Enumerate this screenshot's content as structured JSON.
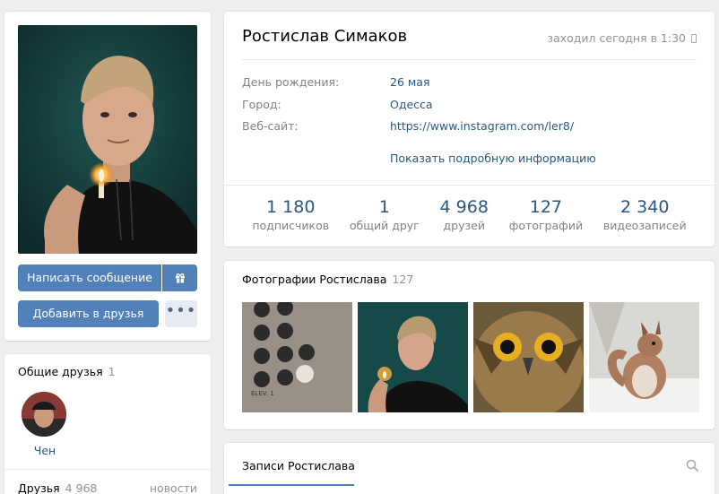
{
  "profile": {
    "name": "Ростислав Симаков",
    "last_seen": "заходил сегодня в 1:30",
    "info": [
      {
        "label": "День рождения:",
        "value": "26 мая"
      },
      {
        "label": "Город:",
        "value": "Одесса"
      },
      {
        "label": "Веб-сайт:",
        "value": "https://www.instagram.com/ler8/"
      }
    ],
    "show_more": "Показать подробную информацию",
    "counters": [
      {
        "value": "1 180",
        "label": "подписчиков"
      },
      {
        "value": "1",
        "label": "общий друг"
      },
      {
        "value": "4 968",
        "label": "друзей"
      },
      {
        "value": "127",
        "label": "фотографий"
      },
      {
        "value": "2 340",
        "label": "видеозаписей"
      }
    ]
  },
  "actions": {
    "message": "Написать сообщение",
    "add_friend": "Добавить в друзья",
    "more": "•••",
    "gift_icon": "gift-icon"
  },
  "mutual": {
    "title": "Общие друзья",
    "count": "1",
    "friends": [
      {
        "name": "Чен"
      }
    ]
  },
  "friends": {
    "title": "Друзья",
    "count": "4 968",
    "news": "новости"
  },
  "photos": {
    "title": "Фотографии Ростислава",
    "count": "127"
  },
  "posts": {
    "tab": "Записи Ростислава",
    "search_icon": "search-icon"
  },
  "colors": {
    "accent": "#5181b8",
    "link": "#2a5885",
    "background": "#edeef0"
  }
}
